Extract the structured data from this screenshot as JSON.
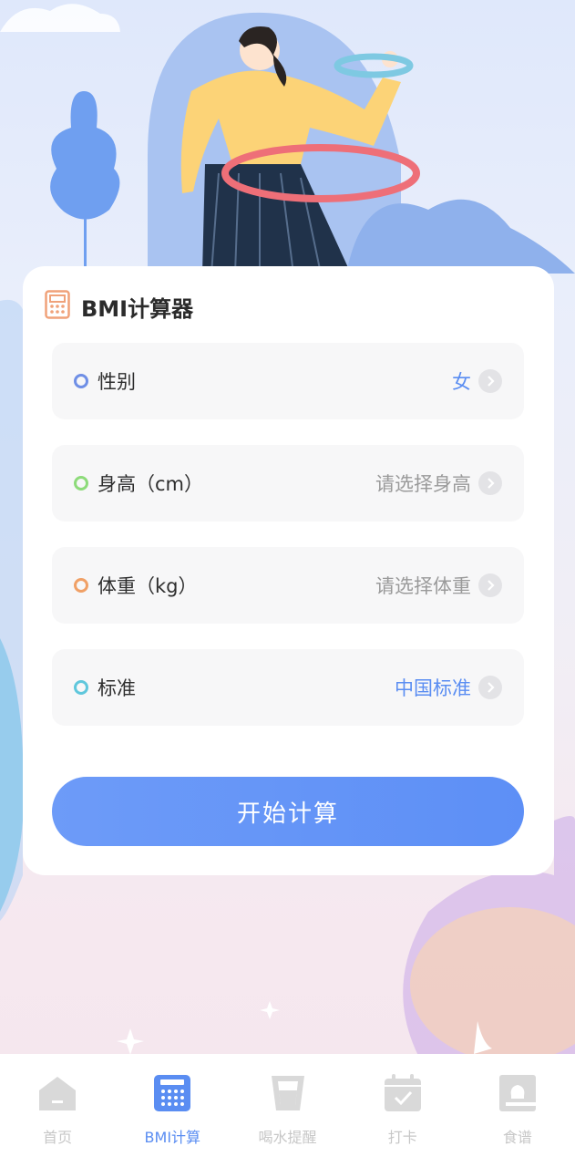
{
  "card": {
    "title": "BMI计算器"
  },
  "rows": [
    {
      "label": "性别",
      "value": "女",
      "dot_color": "#6f8fe6",
      "value_color": "#5a8df2"
    },
    {
      "label": "身高（cm）",
      "value": "请选择身高",
      "dot_color": "#8ddb7a",
      "value_color": "#9a9a9a"
    },
    {
      "label": "体重（kg）",
      "value": "请选择体重",
      "dot_color": "#f0a066",
      "value_color": "#9a9a9a"
    },
    {
      "label": "标准",
      "value": "中国标准",
      "dot_color": "#5fc7dc",
      "value_color": "#5a8df2"
    }
  ],
  "button": {
    "label": "开始计算"
  },
  "tabs": [
    {
      "label": "首页",
      "icon": "home-icon",
      "active": false
    },
    {
      "label": "BMI计算",
      "icon": "calculator-icon",
      "active": true
    },
    {
      "label": "喝水提醒",
      "icon": "cup-icon",
      "active": false
    },
    {
      "label": "打卡",
      "icon": "calendar-check-icon",
      "active": false
    },
    {
      "label": "食谱",
      "icon": "recipe-book-icon",
      "active": false
    }
  ],
  "colors": {
    "accent": "#5a8df2",
    "card_icon": "#f0a27a",
    "inactive_tab": "#c7c7c7"
  }
}
